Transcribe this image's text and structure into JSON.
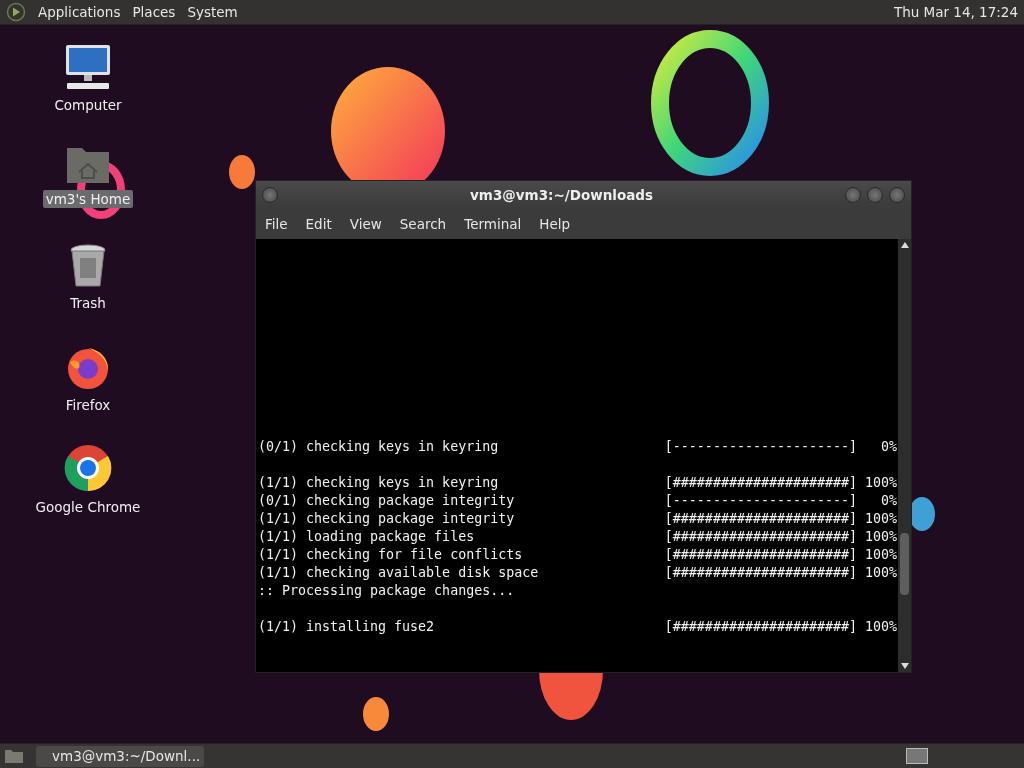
{
  "top_panel": {
    "menus": [
      "Applications",
      "Places",
      "System"
    ],
    "clock": "Thu Mar 14, 17:24"
  },
  "desktop_icons": [
    {
      "kind": "computer",
      "label": "Computer",
      "selected": false
    },
    {
      "kind": "home",
      "label": "vm3's Home",
      "selected": true
    },
    {
      "kind": "trash",
      "label": "Trash",
      "selected": false
    },
    {
      "kind": "firefox",
      "label": "Firefox",
      "selected": false
    },
    {
      "kind": "chrome",
      "label": "Google Chrome",
      "selected": false
    }
  ],
  "window": {
    "title": "vm3@vm3:~/Downloads",
    "menu": [
      "File",
      "Edit",
      "View",
      "Search",
      "Terminal",
      "Help"
    ],
    "terminal_blocks": [
      [
        {
          "text": "(0/1) checking keys in keyring",
          "bar": "[----------------------]",
          "percent": "0%"
        }
      ],
      [
        {
          "text": "(1/1) checking keys in keyring",
          "bar": "[######################]",
          "percent": "100%"
        },
        {
          "text": "(0/1) checking package integrity",
          "bar": "[----------------------]",
          "percent": "0%"
        },
        {
          "text": "(1/1) checking package integrity",
          "bar": "[######################]",
          "percent": "100%"
        },
        {
          "text": "(1/1) loading package files",
          "bar": "[######################]",
          "percent": "100%"
        },
        {
          "text": "(1/1) checking for file conflicts",
          "bar": "[######################]",
          "percent": "100%"
        },
        {
          "text": "(1/1) checking available disk space",
          "bar": "[######################]",
          "percent": "100%"
        },
        {
          "text": ":: Processing package changes..."
        }
      ],
      [
        {
          "text": "(1/1) installing fuse2",
          "bar": "[######################]",
          "percent": "100%"
        }
      ]
    ]
  },
  "taskbar": {
    "items": [
      {
        "label": "vm3@vm3:~/Downl...",
        "selected": false
      }
    ]
  }
}
